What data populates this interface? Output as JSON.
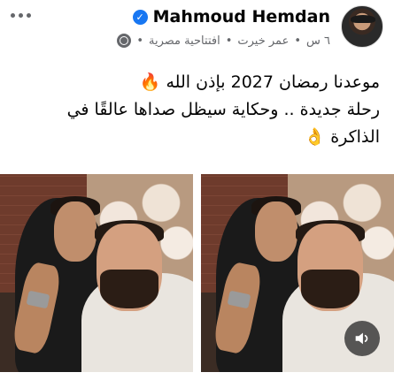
{
  "post": {
    "author": "Mahmoud Hemdan",
    "verified": true,
    "time": "٦ س",
    "location": "عمر خيرت",
    "privacy_label": "افتتاحية مصرية",
    "text_line_1": "موعدنا رمضان 2027 بإذن الله 🔥",
    "text_line_2": "رحلة جديدة .. وحكاية سيظل صداها عالقًا في",
    "text_line_3": "الذاكرة 👌"
  },
  "icons": {
    "more": "more-icon",
    "verified": "verified-badge-icon",
    "globe": "globe-icon",
    "sound": "sound-on-icon"
  },
  "colors": {
    "verified": "#1877f2",
    "meta": "#65676b"
  }
}
